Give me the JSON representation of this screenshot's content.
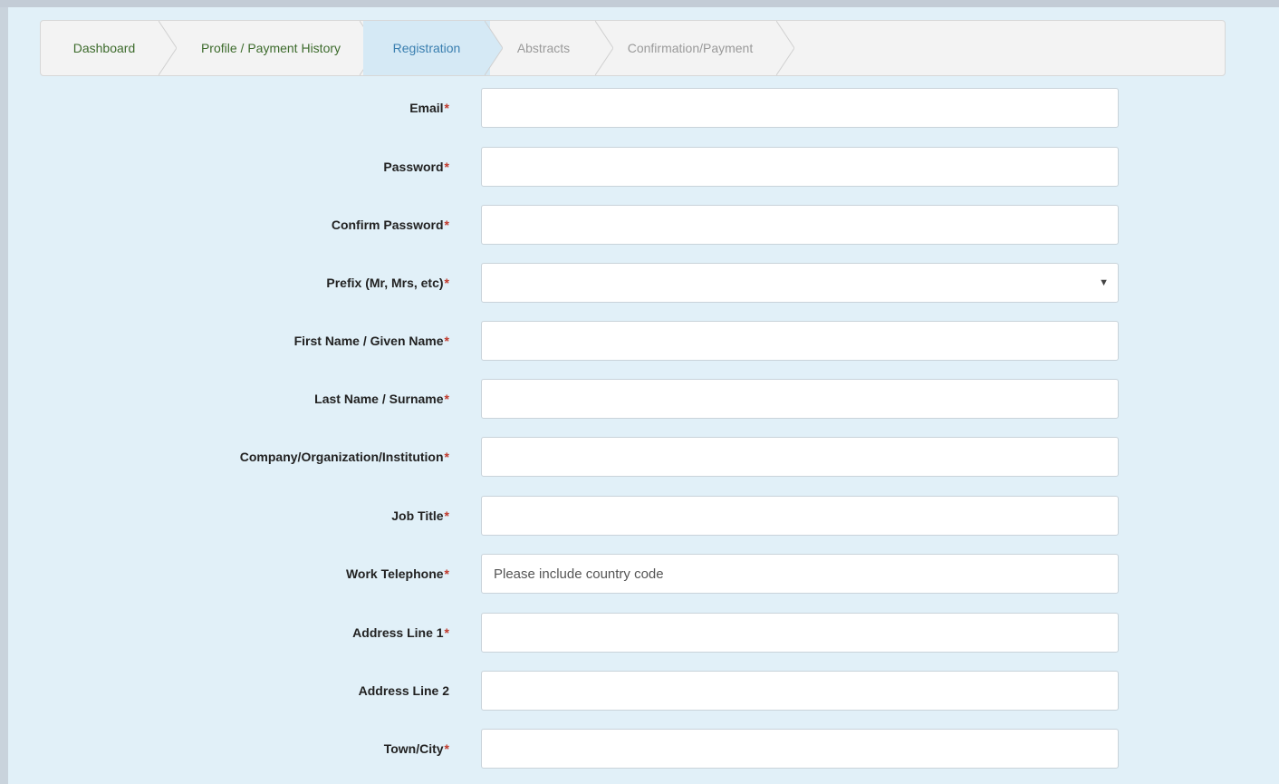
{
  "wizard": {
    "steps": [
      {
        "label": "Dashboard",
        "state": "done"
      },
      {
        "label": "Profile / Payment History",
        "state": "done"
      },
      {
        "label": "Registration",
        "state": "active"
      },
      {
        "label": "Abstracts",
        "state": "todo"
      },
      {
        "label": "Confirmation/Payment",
        "state": "todo"
      }
    ]
  },
  "form": {
    "required_mark": "*",
    "fields": [
      {
        "label": "Email",
        "required": true,
        "type": "text",
        "value": "",
        "placeholder": ""
      },
      {
        "label": "Password",
        "required": true,
        "type": "password",
        "value": "",
        "placeholder": ""
      },
      {
        "label": "Confirm Password",
        "required": true,
        "type": "password",
        "value": "",
        "placeholder": ""
      },
      {
        "label": "Prefix (Mr, Mrs, etc)",
        "required": true,
        "type": "select",
        "value": "",
        "placeholder": ""
      },
      {
        "label": "First Name / Given Name",
        "required": true,
        "type": "text",
        "value": "",
        "placeholder": ""
      },
      {
        "label": "Last Name / Surname",
        "required": true,
        "type": "text",
        "value": "",
        "placeholder": ""
      },
      {
        "label": "Company/Organization/Institution",
        "required": true,
        "type": "text",
        "value": "",
        "placeholder": ""
      },
      {
        "label": "Job Title",
        "required": true,
        "type": "text",
        "value": "",
        "placeholder": ""
      },
      {
        "label": "Work Telephone",
        "required": true,
        "type": "text",
        "value": "",
        "placeholder": "Please include country code"
      },
      {
        "label": "Address Line 1",
        "required": true,
        "type": "text",
        "value": "",
        "placeholder": ""
      },
      {
        "label": "Address Line 2",
        "required": false,
        "type": "text",
        "value": "",
        "placeholder": ""
      },
      {
        "label": "Town/City",
        "required": true,
        "type": "text",
        "value": "",
        "placeholder": ""
      }
    ],
    "select_caret_icon": "caret-down-icon"
  },
  "colors": {
    "panel_bg": "#e1f0f8",
    "active_step_bg": "#d5e9f5",
    "active_step_text": "#3a7fb0",
    "done_step_text": "#3d6b2c",
    "todo_step_text": "#9a9a9a",
    "required_mark": "#c0392b"
  }
}
